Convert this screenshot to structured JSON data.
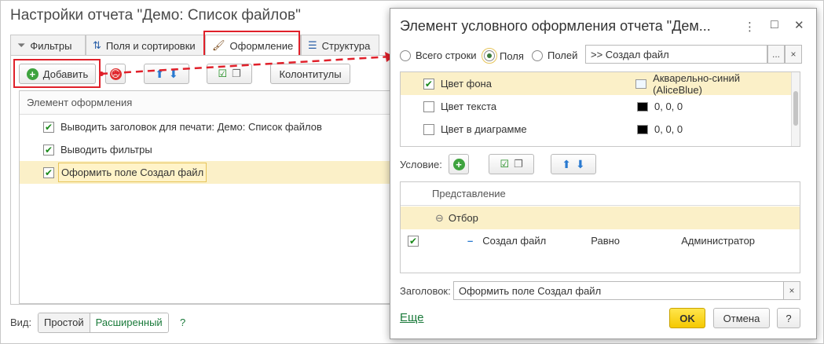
{
  "main": {
    "title": "Настройки отчета \"Демо: Список файлов\"",
    "tabs": [
      {
        "label": "Фильтры",
        "icon": "filter-icon"
      },
      {
        "label": "Поля и сортировки",
        "icon": "fields-icon"
      },
      {
        "label": "Оформление",
        "icon": "brush-icon"
      },
      {
        "label": "Структура",
        "icon": "structure-icon"
      }
    ],
    "toolbar": {
      "add_label": "Добавить",
      "headers_label": "Колонтитулы"
    },
    "grid": {
      "header": "Элемент оформления",
      "rows": [
        {
          "label": "Выводить заголовок для печати: Демо: Список файлов",
          "checked": true
        },
        {
          "label": "Выводить фильтры",
          "checked": true
        },
        {
          "label": "Оформить поле Создал файл",
          "checked": true
        }
      ]
    },
    "view": {
      "label": "Вид:",
      "simple": "Простой",
      "extended": "Расширенный",
      "help": "?"
    }
  },
  "dialog": {
    "title": "Элемент условного оформления отчета \"Дем...",
    "scope": {
      "all_rows": "Всего строки",
      "fields": "Поля",
      "fields_of": "Полей",
      "selected": "Поля"
    },
    "fields_value": ">> Создал файл",
    "field_btn_more": "...",
    "field_btn_clear": "×",
    "appearance": [
      {
        "name": "Цвет фона",
        "value": "Акварельно-синий (AliceBlue)",
        "checked": true,
        "color": "#F0F8FF"
      },
      {
        "name": "Цвет текста",
        "value": "0, 0, 0",
        "checked": false,
        "color": "#000000"
      },
      {
        "name": "Цвет в диаграмме",
        "value": "0, 0, 0",
        "checked": false,
        "color": "#000000"
      }
    ],
    "condition_label": "Условие:",
    "condition_grid": {
      "header": "Представление",
      "group": "Отбор",
      "row": {
        "field": "Создал файл",
        "op": "Равно",
        "value": "Администратор",
        "checked": true
      }
    },
    "caption_label": "Заголовок:",
    "caption_value": "Оформить поле Создал файл",
    "more_link": "Еще",
    "ok": "OK",
    "cancel": "Отмена",
    "help": "?",
    "window_controls": {
      "menu": "⋮",
      "maximize": "□",
      "close": "✕"
    }
  },
  "colors": {
    "accent_green": "#1a8a1a",
    "highlight": "#fbf0c8",
    "annotation_red": "#e0202a",
    "ok_yellow": "#f5c800"
  }
}
